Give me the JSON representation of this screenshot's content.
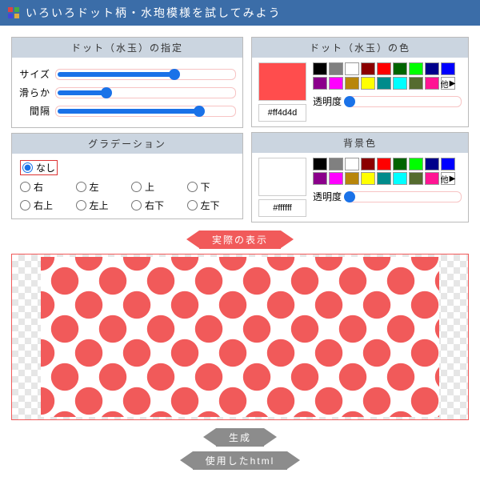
{
  "title": "いろいろドット柄・水玸模様を試してみよう",
  "panels": {
    "spec": "ドット（水玉）の指定",
    "grad": "グラデーション",
    "color": "ドット（水玉）の色",
    "bg": "背景色"
  },
  "sliders": {
    "size": {
      "label": "サイズ",
      "pct": 66
    },
    "smooth": {
      "label": "滑らか",
      "pct": 28
    },
    "gap": {
      "label": "間隔",
      "pct": 80
    }
  },
  "grad_opts": [
    "なし",
    "右",
    "左",
    "上",
    "下",
    "右上",
    "左上",
    "右下",
    "左下"
  ],
  "grad_selected": 0,
  "dot_color": {
    "hex": "#ff4d4d",
    "alpha_label": "透明度",
    "alpha_pct": 2,
    "more": "他"
  },
  "bg_color": {
    "hex": "#ffffff",
    "alpha_label": "透明度",
    "alpha_pct": 2,
    "more": "他"
  },
  "palette": [
    "#000000",
    "#808080",
    "#ffffff",
    "#8b0000",
    "#ff0000",
    "#006400",
    "#00ff00",
    "#00008b",
    "#0000ff",
    "#8b008b",
    "#ff00ff",
    "#b8860b",
    "#ffff00",
    "#008b8b",
    "#00ffff",
    "#556b2f",
    "#ff1493"
  ],
  "ribbons": {
    "preview": "実際の表示",
    "gen": "生成",
    "html": "使用したhtml"
  }
}
